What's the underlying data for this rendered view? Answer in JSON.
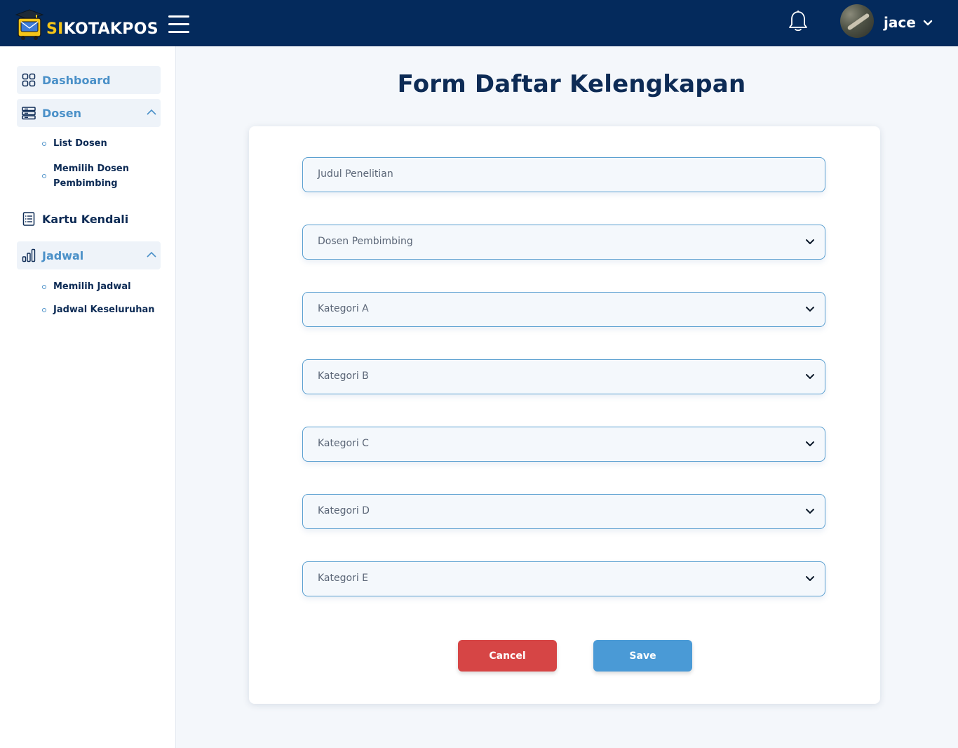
{
  "header": {
    "brand_highlight": "SI",
    "brand_rest": "KOTAKPOS",
    "username": "jace",
    "icons": [
      "logo-icon",
      "menu-icon",
      "bell-icon",
      "avatar",
      "chevron-down-icon"
    ]
  },
  "sidebar": {
    "items": [
      {
        "label": "Dashboard",
        "icon": "dashboard-icon"
      },
      {
        "label": "Dosen",
        "icon": "server-icon",
        "expanded": true,
        "children": [
          {
            "label": "List Dosen"
          },
          {
            "label": "Memilih Dosen Pembimbing"
          }
        ]
      },
      {
        "label": "Kartu Kendali",
        "icon": "document-list-icon"
      },
      {
        "label": "Jadwal",
        "icon": "bar-chart-icon",
        "expanded": true,
        "children": [
          {
            "label": "Memilih Jadwal"
          },
          {
            "label": "Jadwal Keseluruhan"
          }
        ]
      }
    ]
  },
  "main": {
    "title": "Form Daftar Kelengkapan",
    "fields": [
      {
        "placeholder": "Judul Penelitian",
        "type": "text"
      },
      {
        "placeholder": "Dosen Pembimbing",
        "type": "select"
      },
      {
        "placeholder": "Kategori A",
        "type": "select"
      },
      {
        "placeholder": "Kategori B",
        "type": "select"
      },
      {
        "placeholder": "Kategori C",
        "type": "select"
      },
      {
        "placeholder": "Kategori D",
        "type": "select"
      },
      {
        "placeholder": "Kategori E",
        "type": "select"
      }
    ],
    "cancel_label": "Cancel",
    "save_label": "Save"
  },
  "colors": {
    "header_bg": "#042a5c",
    "brand_accent": "#f5c518",
    "active_nav": "#4a90c8",
    "nav_text": "#0d2b55",
    "cancel": "#d64545",
    "save": "#4a9ad6",
    "field_border": "#5a9fd0"
  }
}
